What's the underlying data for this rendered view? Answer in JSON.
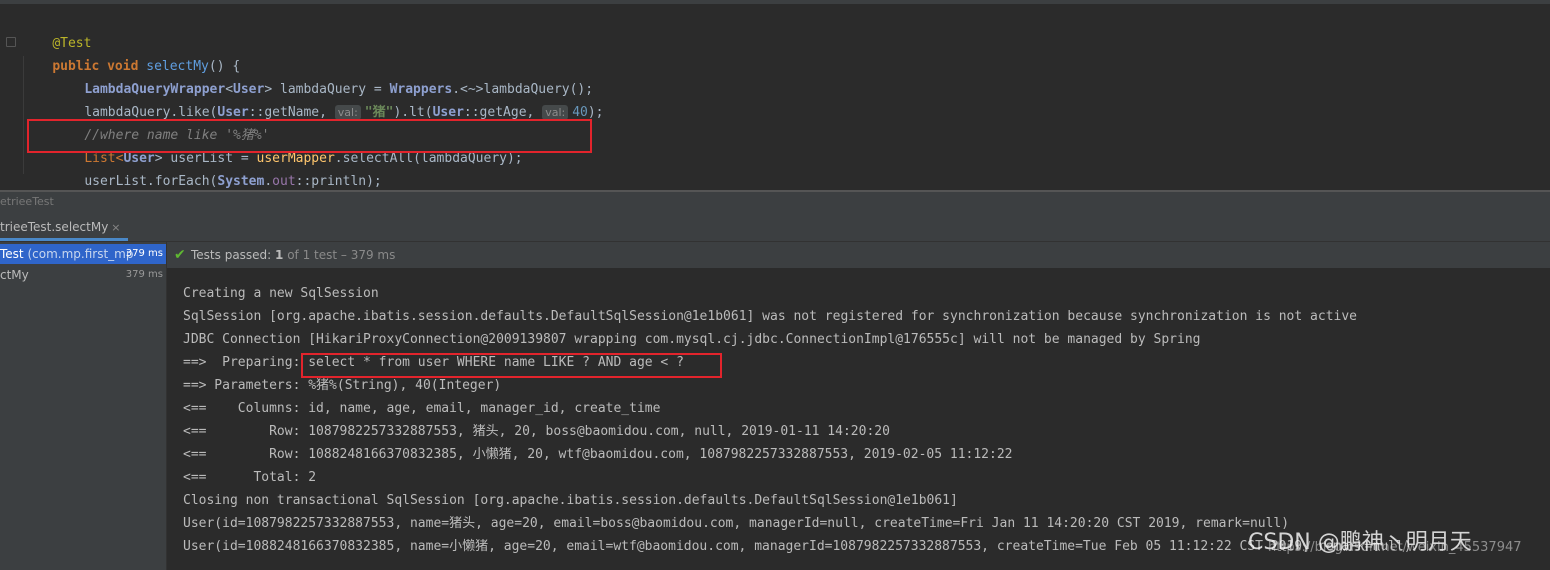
{
  "editor": {
    "lines": {
      "annotation": "@Test",
      "method_kw1": "public",
      "method_kw2": "void",
      "method_name": "selectMy",
      "method_rest": "() {",
      "l3_type": "LambdaQueryWrapper",
      "l3_lt": "<",
      "l3_user": "User",
      "l3_mid": "> lambdaQuery = ",
      "l3_wrappers": "Wrappers",
      "l3_call": ".<~>lambdaQuery();",
      "l4_a": "lambdaQuery.like(",
      "l4_user": "User",
      "l4_b": "::getName, ",
      "l4_hint1": "val:",
      "l4_str": "\"猪\"",
      "l4_c": ").lt(",
      "l4_user2": "User",
      "l4_d": "::getAge, ",
      "l4_hint2": "val:",
      "l4_num": "40",
      "l4_e": ");",
      "l5_comment": "//where name like '%猪%'",
      "l6_list": "List<",
      "l6_user": "User",
      "l6_mid": "> userList = ",
      "l6_mapper": "userMapper",
      "l6_rest": ".selectAll(lambdaQuery);",
      "l7_a": "userList.forEach(",
      "l7_system": "System",
      "l7_dot": ".",
      "l7_out": "out",
      "l7_rest": "::println);",
      "l8_brace": "}"
    }
  },
  "run_window": {
    "title": "etrieeTest",
    "tab_label": "trieeTest.selectMy",
    "tab_close": "×",
    "tree": [
      {
        "label": "Test",
        "sub": " (com.mp.first_mp",
        "time": "379 ms"
      },
      {
        "label": "ctMy",
        "sub": "",
        "time": "379 ms"
      }
    ],
    "status": {
      "prefix": "Tests passed: ",
      "passed": "1",
      "suffix": " of 1 test – 379 ms"
    }
  },
  "console": {
    "lines": [
      "Creating a new SqlSession",
      "SqlSession [org.apache.ibatis.session.defaults.DefaultSqlSession@1e1b061] was not registered for synchronization because synchronization is not active",
      "JDBC Connection [HikariProxyConnection@2009139807 wrapping com.mysql.cj.jdbc.ConnectionImpl@176555c] will not be managed by Spring",
      "==>  Preparing: select * from user WHERE name LIKE ? AND age < ?",
      "==> Parameters: %猪%(String), 40(Integer)",
      "<==    Columns: id, name, age, email, manager_id, create_time",
      "<==        Row: 1087982257332887553, 猪头, 20, boss@baomidou.com, null, 2019-01-11 14:20:20",
      "<==        Row: 1088248166370832385, 小懒猪, 20, wtf@baomidou.com, 1087982257332887553, 2019-02-05 11:12:22",
      "<==      Total: 2",
      "Closing non transactional SqlSession [org.apache.ibatis.session.defaults.DefaultSqlSession@1e1b061]",
      "User(id=1087982257332887553, name=猪头, age=20, email=boss@baomidou.com, managerId=null, createTime=Fri Jan 11 14:20:20 CST 2019, remark=null)",
      "User(id=1088248166370832385, name=小懒猪, age=20, email=wtf@baomidou.com, managerId=1087982257332887553, createTime=Tue Feb 05 11:12:22 CST 2019, remark=null)"
    ]
  },
  "watermark": {
    "text": "CSDN @鹏神丶明月天",
    "url": "https://blog.csdn.net/weixin_45537947"
  },
  "colors": {
    "highlight_box": "#e2242c",
    "tab_underline": "#4a88c7",
    "pass_green": "#5fb832"
  }
}
